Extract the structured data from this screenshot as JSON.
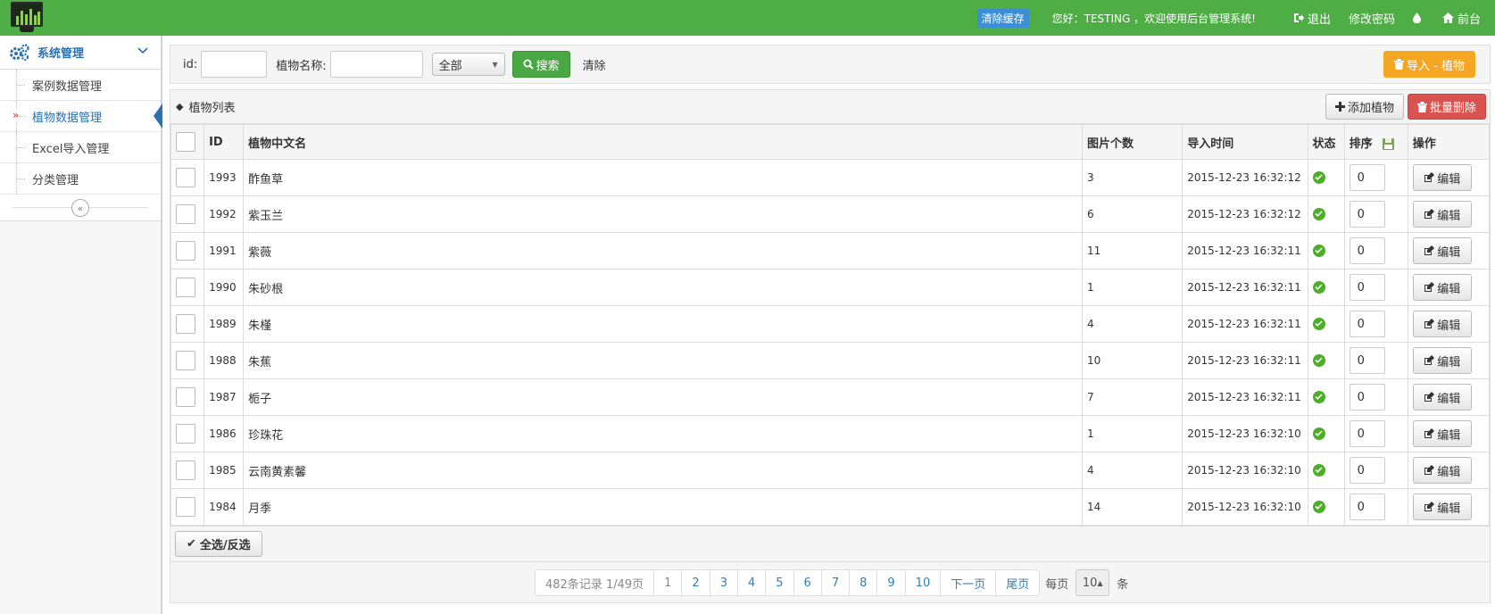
{
  "topbar": {
    "cache_btn": "清除缓存",
    "welcome": "您好：TESTING ，欢迎使用后台管理系统!",
    "logout": "退出",
    "change_pwd": "修改密码",
    "frontend": "前台"
  },
  "sidebar": {
    "title": "系统管理",
    "items": [
      {
        "label": "案例数据管理"
      },
      {
        "label": "植物数据管理"
      },
      {
        "label": "Excel导入管理"
      },
      {
        "label": "分类管理"
      }
    ]
  },
  "filter": {
    "id_label": "id:",
    "id_value": "",
    "name_label": "植物名称:",
    "name_value": "",
    "select_value": "全部",
    "search_btn": "搜索",
    "clear_link": "清除",
    "import_btn": "导入 - 植物"
  },
  "list": {
    "title": "植物列表",
    "add_btn": "添加植物",
    "batch_delete_btn": "批量删除",
    "columns": {
      "id": "ID",
      "name": "植物中文名",
      "pic_count": "图片个数",
      "import_time": "导入时间",
      "status": "状态",
      "sort": "排序",
      "action": "操作"
    },
    "edit_label": "编辑",
    "rows": [
      {
        "id": "1993",
        "name": "酢鱼草",
        "pic_count": "3",
        "import_time": "2015-12-23 16:32:12",
        "sort": "0"
      },
      {
        "id": "1992",
        "name": "紫玉兰",
        "pic_count": "6",
        "import_time": "2015-12-23 16:32:12",
        "sort": "0"
      },
      {
        "id": "1991",
        "name": "紫薇",
        "pic_count": "11",
        "import_time": "2015-12-23 16:32:11",
        "sort": "0"
      },
      {
        "id": "1990",
        "name": "朱砂根",
        "pic_count": "1",
        "import_time": "2015-12-23 16:32:11",
        "sort": "0"
      },
      {
        "id": "1989",
        "name": "朱槿",
        "pic_count": "4",
        "import_time": "2015-12-23 16:32:11",
        "sort": "0"
      },
      {
        "id": "1988",
        "name": "朱蕉",
        "pic_count": "10",
        "import_time": "2015-12-23 16:32:11",
        "sort": "0"
      },
      {
        "id": "1987",
        "name": "栀子",
        "pic_count": "7",
        "import_time": "2015-12-23 16:32:11",
        "sort": "0"
      },
      {
        "id": "1986",
        "name": "珍珠花",
        "pic_count": "1",
        "import_time": "2015-12-23 16:32:10",
        "sort": "0"
      },
      {
        "id": "1985",
        "name": "云南黄素馨",
        "pic_count": "4",
        "import_time": "2015-12-23 16:32:10",
        "sort": "0"
      },
      {
        "id": "1984",
        "name": "月季",
        "pic_count": "14",
        "import_time": "2015-12-23 16:32:10",
        "sort": "0"
      }
    ],
    "select_all_btn": "全选/反选"
  },
  "pager": {
    "summary": "482条记录 1/49页",
    "pages": [
      "1",
      "2",
      "3",
      "4",
      "5",
      "6",
      "7",
      "8",
      "9",
      "10"
    ],
    "next": "下一页",
    "last": "尾页",
    "per_page_label": "每页",
    "per_page_value": "10",
    "per_page_unit": "条"
  },
  "colors": {
    "topbar": "#4ead45",
    "primary_blue": "#2b6fb5",
    "orange": "#f5a623",
    "danger": "#d9534f",
    "success": "#4aa844"
  }
}
